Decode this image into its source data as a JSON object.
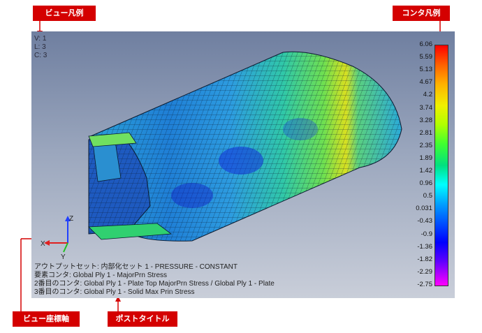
{
  "callouts": {
    "view_legend": "ビュー凡例",
    "contour_legend": "コンタ凡例",
    "view_axes": "ビュー座標軸",
    "post_title": "ポストタイトル"
  },
  "view_legend": [
    "V: 1",
    "L: 3",
    "C: 3"
  ],
  "contour_legend": {
    "values": [
      "6.06",
      "5.59",
      "5.13",
      "4.67",
      "4.2",
      "3.74",
      "3.28",
      "2.81",
      "2.35",
      "1.89",
      "1.42",
      "0.96",
      "0.5",
      "0.031",
      "-0.43",
      "-0.9",
      "-1.36",
      "-1.82",
      "-2.29",
      "-2.75"
    ]
  },
  "axes": {
    "z": "Z",
    "x": "X",
    "y": "Y"
  },
  "post_title": [
    "アウトプットセット: 内部化セット 1 - PRESSURE - CONSTANT",
    "要素コンタ: Global Ply 1 - MajorPrn Stress",
    "2番目のコンタ: Global Ply 1 - Plate Top MajorPrn Stress / Global Ply 1 - Plate",
    "3番目のコンタ: Global Ply 1 - Solid Max Prin Stress"
  ],
  "colors": {
    "callout": "#d40000",
    "viewport_top": "#6f7fa0",
    "viewport_bottom": "#c9ced9"
  }
}
